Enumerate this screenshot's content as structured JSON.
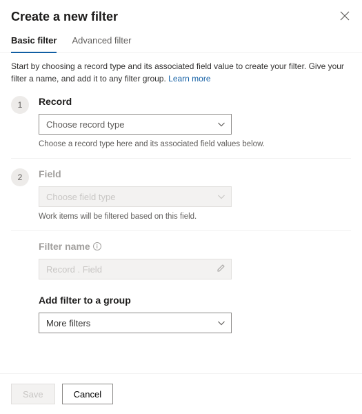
{
  "header": {
    "title": "Create a new filter"
  },
  "tabs": {
    "basic": "Basic filter",
    "advanced": "Advanced filter",
    "active": "basic"
  },
  "intro": {
    "text": "Start by choosing a record type and its associated field value to create your filter. Give your filter a name, and add it to any filter group. ",
    "link_label": "Learn more"
  },
  "steps": {
    "record": {
      "number": "1",
      "label": "Record",
      "placeholder": "Choose record type",
      "caption": "Choose a record type here and its associated field values below."
    },
    "field": {
      "number": "2",
      "label": "Field",
      "placeholder": "Choose field type",
      "caption": "Work items will be filtered based on this field."
    },
    "filter_name": {
      "label": "Filter name",
      "placeholder": "Record . Field"
    },
    "add_group": {
      "label": "Add filter to a group",
      "value": "More filters"
    }
  },
  "footer": {
    "save": "Save",
    "cancel": "Cancel"
  }
}
